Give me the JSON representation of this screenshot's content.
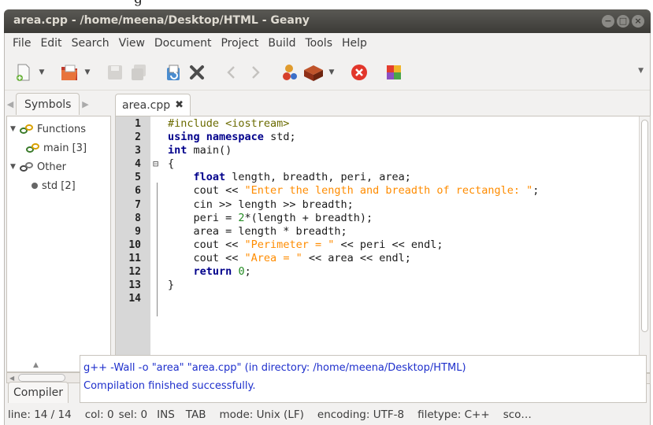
{
  "window": {
    "caption_fragment": "g",
    "title": "area.cpp - /home/meena/Desktop/HTML - Geany",
    "buttons": [
      "−",
      "□",
      "×"
    ]
  },
  "menu": [
    "File",
    "Edit",
    "Search",
    "View",
    "Document",
    "Project",
    "Build",
    "Tools",
    "Help"
  ],
  "toolbar": {
    "icons": [
      "new-file-icon",
      "open-file-icon",
      "save-icon",
      "save-all-icon",
      "revert-icon",
      "close-icon",
      "back-icon",
      "forward-icon",
      "compile-icon",
      "build-icon",
      "stop-icon",
      "color-chooser-icon"
    ]
  },
  "sidebar": {
    "tab": "Symbols",
    "tree": [
      {
        "label": "Functions",
        "level": 0,
        "toggle": "▼"
      },
      {
        "label": "main [3]",
        "level": 1,
        "toggle": ""
      },
      {
        "label": "Other",
        "level": 0,
        "toggle": "▼"
      },
      {
        "label": "std [2]",
        "level": 1,
        "toggle": ""
      }
    ]
  },
  "editor": {
    "tab": "area.cpp",
    "lines": [
      {
        "n": "1",
        "fold": "",
        "parts": [
          [
            "prep",
            "#include <iostream>"
          ]
        ]
      },
      {
        "n": "2",
        "fold": "",
        "parts": [
          [
            "kw",
            "using"
          ],
          [
            "",
            " "
          ],
          [
            "kw",
            "namespace"
          ],
          [
            "",
            " std;"
          ]
        ]
      },
      {
        "n": "3",
        "fold": "",
        "parts": [
          [
            "kw",
            "int"
          ],
          [
            "",
            " main()"
          ]
        ]
      },
      {
        "n": "4",
        "fold": "⊟",
        "parts": [
          [
            "",
            "{"
          ]
        ]
      },
      {
        "n": "5",
        "fold": "",
        "parts": [
          [
            "",
            "    "
          ],
          [
            "kw",
            "float"
          ],
          [
            "",
            " length, breadth, peri, area;"
          ]
        ]
      },
      {
        "n": "6",
        "fold": "",
        "parts": [
          [
            "",
            "    cout << "
          ],
          [
            "str",
            "\"Enter the length and breadth of rectangle: \""
          ],
          [
            "",
            ";"
          ]
        ]
      },
      {
        "n": "7",
        "fold": "",
        "parts": [
          [
            "",
            "    cin >> length >> breadth;"
          ]
        ]
      },
      {
        "n": "8",
        "fold": "",
        "parts": [
          [
            "",
            "    peri = "
          ],
          [
            "num",
            "2"
          ],
          [
            "",
            "*(length + breadth);"
          ]
        ]
      },
      {
        "n": "9",
        "fold": "",
        "parts": [
          [
            "",
            "    area = length * breadth;"
          ]
        ]
      },
      {
        "n": "10",
        "fold": "",
        "parts": [
          [
            "",
            "    cout << "
          ],
          [
            "str",
            "\"Perimeter = \""
          ],
          [
            "",
            " << peri << endl;"
          ]
        ]
      },
      {
        "n": "11",
        "fold": "",
        "parts": [
          [
            "",
            "    cout << "
          ],
          [
            "str",
            "\"Area = \""
          ],
          [
            "",
            " << area << endl;"
          ]
        ]
      },
      {
        "n": "12",
        "fold": "",
        "parts": [
          [
            "",
            "    "
          ],
          [
            "kw",
            "return"
          ],
          [
            "",
            " "
          ],
          [
            "num",
            "0"
          ],
          [
            "",
            ";"
          ]
        ]
      },
      {
        "n": "13",
        "fold": "",
        "parts": [
          [
            "",
            "}"
          ]
        ]
      },
      {
        "n": "14",
        "fold": "",
        "parts": [
          [
            "",
            ""
          ]
        ]
      }
    ]
  },
  "messages": {
    "tab": "Compiler",
    "lines": [
      "g++ -Wall -o \"area\" \"area.cpp\" (in directory: /home/meena/Desktop/HTML)",
      "Compilation finished successfully."
    ]
  },
  "status": {
    "line": "line: 14 / 14",
    "col": "col: 0",
    "sel": "sel: 0",
    "ins": "INS",
    "tab": "TAB",
    "mode": "mode: Unix (LF)",
    "encoding": "encoding: UTF-8",
    "filetype": "filetype: C++",
    "scope": "sco…"
  }
}
